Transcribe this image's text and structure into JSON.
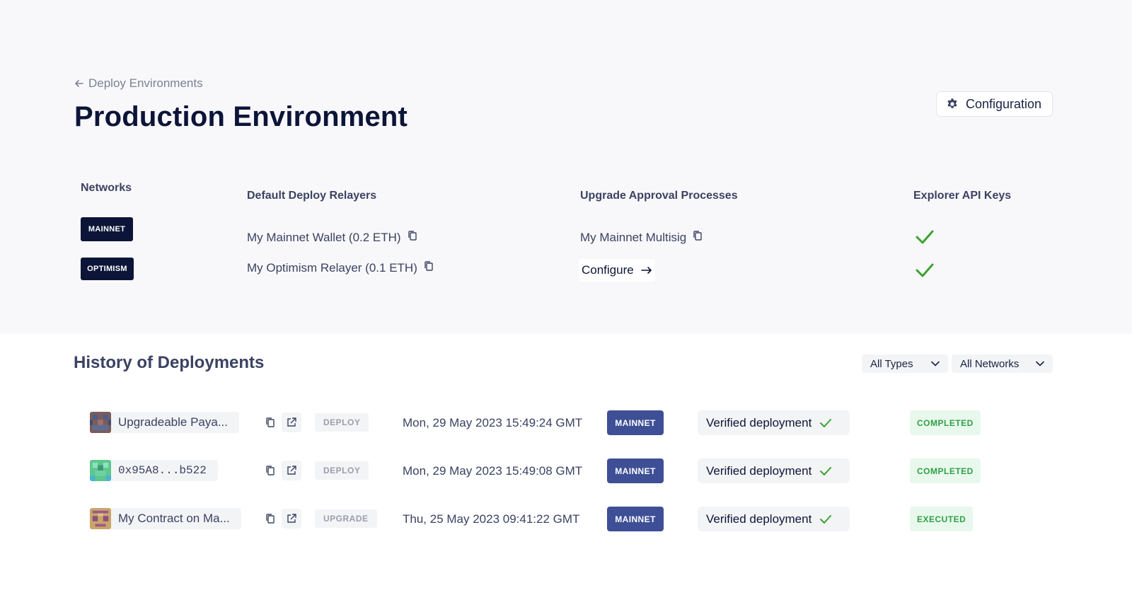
{
  "header": {
    "back_label": "Deploy Environments",
    "title": "Production Environment",
    "config_button": "Configuration"
  },
  "summary": {
    "columns": {
      "networks": "Networks",
      "relayers": "Default Deploy Relayers",
      "approvals": "Upgrade Approval Processes",
      "api_keys": "Explorer API Keys"
    },
    "rows": [
      {
        "network": "MAINNET",
        "relayer": "My Mainnet Wallet (0.2 ETH)",
        "approval": "My Mainnet Multisig",
        "api_key_ok": true
      },
      {
        "network": "OPTIMISM",
        "relayer": "My Optimism Relayer (0.1 ETH)",
        "approval_action": "Configure",
        "api_key_ok": true
      }
    ],
    "check_color": "#3aa32f"
  },
  "history": {
    "title": "History of Deployments",
    "filter_types": "All Types",
    "filter_networks": "All Networks",
    "rows": [
      {
        "name": "Upgradeable Paya...",
        "type": "DEPLOY",
        "date": "Mon, 29 May 2023 15:49:24 GMT",
        "network": "MAINNET",
        "verification": "Verified deployment",
        "status": "COMPLETED"
      },
      {
        "name": "0x95A8...b522",
        "type": "DEPLOY",
        "date": "Mon, 29 May 2023 15:49:08 GMT",
        "network": "MAINNET",
        "verification": "Verified deployment",
        "status": "COMPLETED"
      },
      {
        "name": "My Contract on Ma...",
        "type": "UPGRADE",
        "date": "Thu, 25 May 2023 09:41:22 GMT",
        "network": "MAINNET",
        "verification": "Verified deployment",
        "status": "EXECUTED"
      }
    ]
  },
  "colors": {
    "navy": "#0c1538",
    "badge_blue": "#3e4f96",
    "success_green": "#2fa147"
  }
}
